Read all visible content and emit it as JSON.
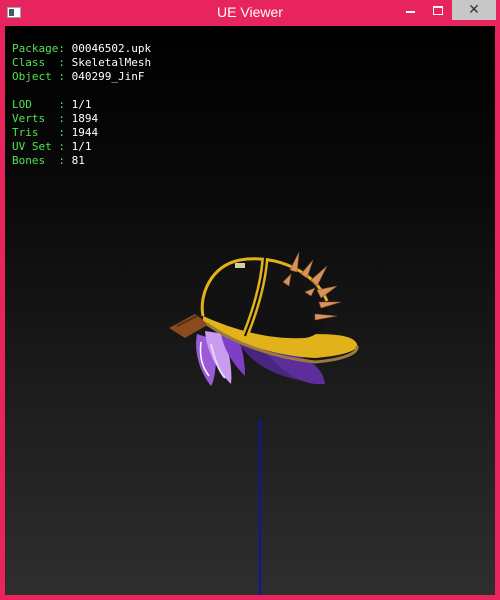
{
  "window": {
    "title": "UE Viewer",
    "controls": {
      "minimize": "minimize",
      "maximize": "maximize",
      "close": "✕"
    }
  },
  "info": {
    "package": {
      "label": "Package:",
      "value": "00046502.upk"
    },
    "class": {
      "label": "Class  :",
      "value": "SkeletalMesh"
    },
    "object": {
      "label": "Object :",
      "value": "040299_JinF"
    },
    "lod": {
      "label": "LOD    :",
      "value": "1/1"
    },
    "verts": {
      "label": "Verts  :",
      "value": "1894"
    },
    "tris": {
      "label": "Tris   :",
      "value": "1944"
    },
    "uvset": {
      "label": "UV Set :",
      "value": "1/1"
    },
    "bones": {
      "label": "Bones  :",
      "value": "81"
    }
  },
  "colors": {
    "frame": "#e8245f",
    "label_text": "#55e055",
    "value_text": "#ffffff",
    "axis": "#1212a8"
  }
}
